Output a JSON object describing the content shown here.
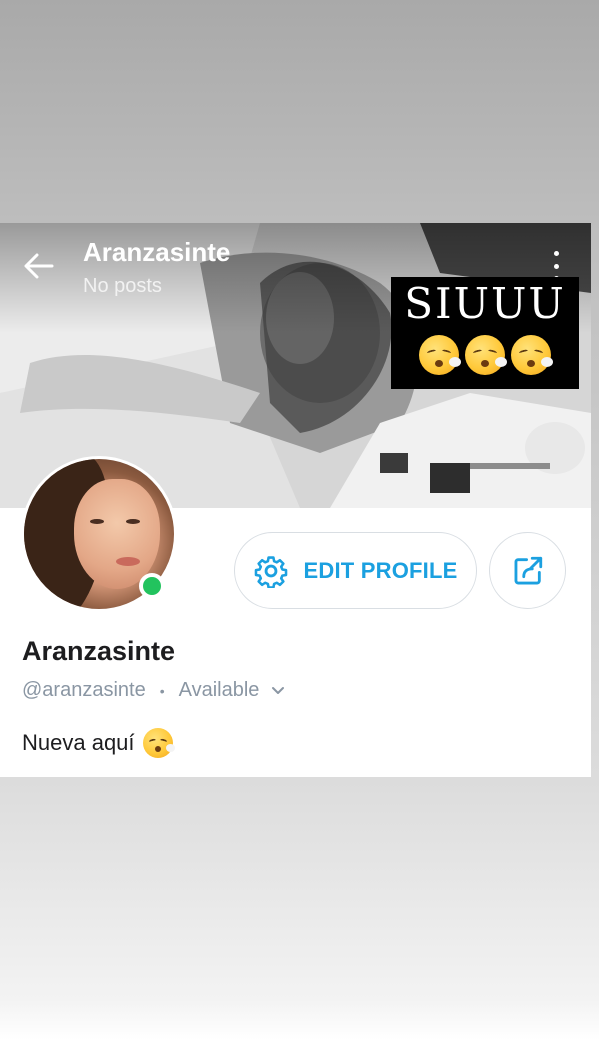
{
  "header": {
    "title": "Aranzasinte",
    "subtitle": "No posts"
  },
  "cover": {
    "sticker_text": "SIUUU",
    "sticker_emoji": [
      "face-exhaling",
      "face-exhaling",
      "face-exhaling"
    ]
  },
  "profile": {
    "display_name": "Aranzasinte",
    "handle": "@aranzasinte",
    "separator": "•",
    "status": "Available",
    "online": true,
    "bio": "Nueva aquí"
  },
  "actions": {
    "edit_profile_label": "EDIT PROFILE"
  },
  "colors": {
    "accent": "#1ba0e0",
    "online": "#22c35e",
    "muted_text": "#8a96a3"
  },
  "icons": {
    "back": "arrow-left-icon",
    "more": "more-vertical-icon",
    "settings": "gear-icon",
    "share": "share-icon",
    "status_dropdown": "chevron-down-icon"
  }
}
